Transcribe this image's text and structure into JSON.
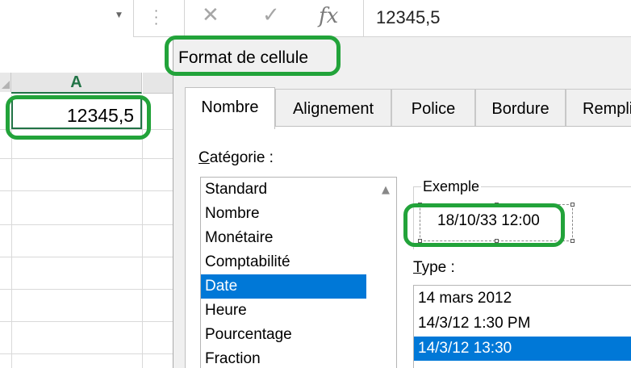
{
  "formula_bar": {
    "cancel_icon": "✕",
    "enter_icon": "✓",
    "fx_label": "fx",
    "value": "12345,5"
  },
  "sheet": {
    "column_a": "A",
    "cell_a1": "12345,5"
  },
  "dialog": {
    "title": "Format de cellule",
    "tabs": [
      {
        "label": "Nombre"
      },
      {
        "label": "Alignement"
      },
      {
        "label": "Police"
      },
      {
        "label": "Bordure"
      },
      {
        "label": "Rempli"
      }
    ],
    "category_label_first": "C",
    "category_label_rest": "atégorie :",
    "categories": [
      {
        "label": "Standard"
      },
      {
        "label": "Nombre"
      },
      {
        "label": "Monétaire"
      },
      {
        "label": "Comptabilité"
      },
      {
        "label": "Date"
      },
      {
        "label": "Heure"
      },
      {
        "label": "Pourcentage"
      },
      {
        "label": "Fraction"
      }
    ],
    "selected_category": "Date",
    "exemple_label": "Exemple",
    "exemple_value": "18/10/33 12:00",
    "type_label_first": "T",
    "type_label_rest": "ype :",
    "types": [
      {
        "label": "14 mars 2012"
      },
      {
        "label": "14/3/12 1:30 PM"
      },
      {
        "label": "14/3/12 13:30"
      }
    ],
    "selected_type": "14/3/12 13:30"
  },
  "colors": {
    "highlight_ring": "#22a33a",
    "selection": "#0078d7",
    "excel_green": "#217346"
  }
}
